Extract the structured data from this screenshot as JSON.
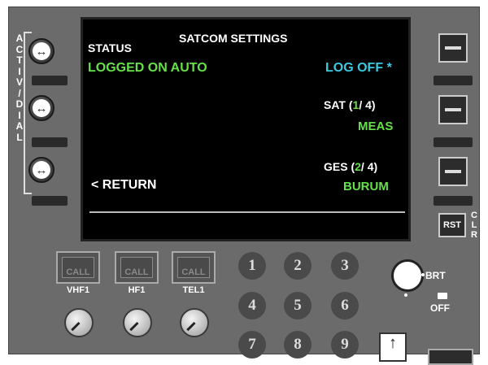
{
  "screen": {
    "title": "SATCOM SETTINGS",
    "status_label": "STATUS",
    "status_value": "LOGGED ON AUTO",
    "log_off": "LOG OFF",
    "log_off_star": "*",
    "sat_label": "SAT (",
    "sat_index": "1",
    "sat_total": "/ 4)",
    "sat_value": "MEAS",
    "ges_label": "GES (",
    "ges_index": "2",
    "ges_total": "/ 4)",
    "ges_value": "BURUM",
    "return_label": "< RETURN"
  },
  "left_side": {
    "active_dial_label": "ACTIVE/DIAL"
  },
  "right_side": {
    "rst_label": "RST",
    "clr_label": "CLR"
  },
  "call_buttons": [
    {
      "label": "CALL",
      "name": "VHF1"
    },
    {
      "label": "CALL",
      "name": "HF1"
    },
    {
      "label": "CALL",
      "name": "TEL1"
    }
  ],
  "keypad": [
    "1",
    "2",
    "3",
    "4",
    "5",
    "6",
    "7",
    "8",
    "9"
  ],
  "brightness": {
    "brt_label": "BRT",
    "off_label": "OFF"
  },
  "colors": {
    "white": "#ffffff",
    "green": "#66e04a",
    "cyan": "#3cc8e0",
    "bezel": "#6b6b6b"
  }
}
